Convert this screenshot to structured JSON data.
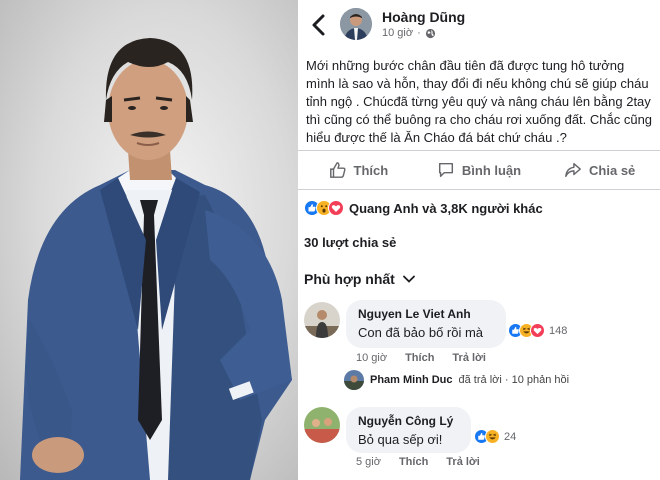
{
  "post": {
    "author": "Hoàng Dũng",
    "time": "10 giờ",
    "separator": "·",
    "text": "Mới những bước chân đầu tiên đã được tung hô tưởng mình là sao và hỗn, thay đổi đi nếu không chú sẽ giúp cháu tỉnh ngộ . Chúcđã từng yêu quý và nâng cháu lên bằng 2tay thì cũng có thể buông ra cho cháu rơi xuống đất. Chắc cũng hiểu được thế là Ăn Cháo đá bát chứ cháu .?"
  },
  "actions": {
    "like": "Thích",
    "comment": "Bình luận",
    "share": "Chia sẻ"
  },
  "reactions": {
    "summary": "Quang Anh và 3,8K người khác",
    "icons": [
      "like-icon",
      "wow-icon",
      "love-icon"
    ]
  },
  "shares": "30 lượt chia sẻ",
  "sort_label": "Phù hợp nhất",
  "comments": [
    {
      "name": "Nguyen Le Viet Anh",
      "text": "Con đã bảo bố rồi mà",
      "reaction_count": "148",
      "time": "10 giờ",
      "like": "Thích",
      "reply": "Trả lời"
    },
    {
      "name": "Nguyễn Công Lý",
      "text": "Bỏ qua sếp ơi!",
      "reaction_count": "24",
      "time": "5 giờ",
      "like": "Thích",
      "reply": "Trả lời"
    }
  ],
  "reply_summary": {
    "name": "Pham Minh Duc",
    "text": "đã trả lời · 10 phản hồi"
  },
  "colors": {
    "like_blue": "#1877f2",
    "love_red": "#f33e58",
    "wow_yellow": "#f7b125",
    "muted": "#65676b",
    "bubble": "#f0f2f5"
  }
}
